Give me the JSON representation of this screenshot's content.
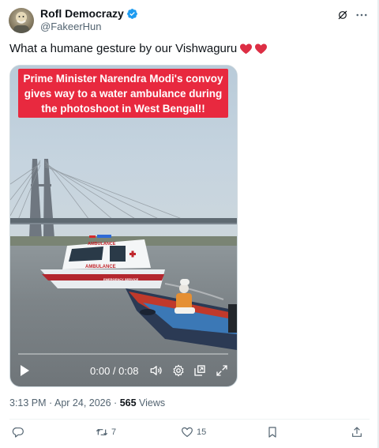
{
  "author": {
    "display_name": "Rofl Democrazy",
    "handle": "@FakeerHun",
    "verified": true
  },
  "tweet": {
    "text": "What a humane gesture by our Vishwaguru",
    "emoji": [
      "red-heart",
      "red-heart"
    ]
  },
  "media": {
    "banner_text": "Prime Minister Narendra Modi's convoy gives way to a water ambulance during the photoshoot in West Bengal!!",
    "boat_label_top": "AMBULANCE",
    "boat_label_side": "AMBULANCE",
    "boat_label_small": "EMERGENCY SERVICE",
    "time_display": "0:00 / 0:08",
    "progress_fraction": 0.0
  },
  "meta": {
    "time": "3:13 PM",
    "separator_1": " · ",
    "date": "Apr 24, 2026",
    "separator_2": " · ",
    "views_count": "565",
    "views_label": " Views"
  },
  "actions": {
    "reply_count": "",
    "retweet_count": "7",
    "like_count": "15"
  },
  "colors": {
    "accent": "#1d9bf0",
    "banner": "#e8293f",
    "text_primary": "#0f1419",
    "text_secondary": "#536471"
  }
}
